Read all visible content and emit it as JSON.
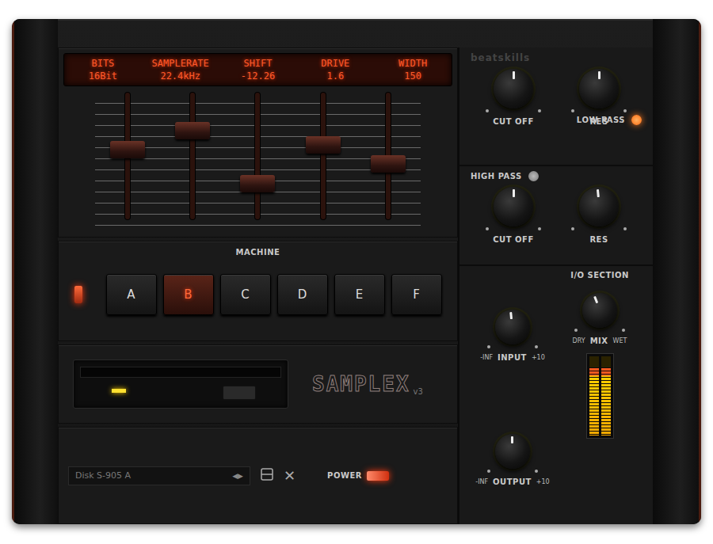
{
  "brand": "beatskills",
  "lcd": [
    {
      "label": "BITS",
      "value": "16Bit",
      "level": 0.56
    },
    {
      "label": "SAMPLERATE",
      "value": "22.4kHz",
      "level": 0.73
    },
    {
      "label": "SHIFT",
      "value": "-12.26",
      "level": 0.25
    },
    {
      "label": "DRIVE",
      "value": "1.6",
      "level": 0.6
    },
    {
      "label": "WIDTH",
      "value": "150",
      "level": 0.43
    }
  ],
  "machine": {
    "label": "MACHINE",
    "switch_on": true,
    "buttons": [
      {
        "label": "A",
        "selected": false
      },
      {
        "label": "B",
        "selected": true
      },
      {
        "label": "C",
        "selected": false
      },
      {
        "label": "D",
        "selected": false
      },
      {
        "label": "E",
        "selected": false
      },
      {
        "label": "F",
        "selected": false
      }
    ]
  },
  "drive": {
    "led_on": true,
    "logo": "SAMPLEX",
    "version": "v3"
  },
  "preset": {
    "name": "Disk S-905 A",
    "arrows": "◀▶",
    "close": "✕"
  },
  "power": {
    "label": "POWER",
    "on": true
  },
  "low_pass": {
    "label": "LOW PASS",
    "on": true,
    "knobs": [
      {
        "label": "CUT OFF",
        "level": 0.5
      },
      {
        "label": "RES",
        "level": 0.5
      }
    ]
  },
  "high_pass": {
    "label": "HIGH PASS",
    "on": false,
    "knobs": [
      {
        "label": "CUT OFF",
        "level": 0.5
      },
      {
        "label": "RES",
        "level": 0.48
      }
    ]
  },
  "io": {
    "title": "I/O SECTION",
    "mix": {
      "label": "MIX",
      "min": "DRY",
      "max": "WET",
      "level": 0.42
    },
    "input": {
      "label": "INPUT",
      "min": "-INF",
      "max": "+10",
      "level": 0.48
    },
    "output": {
      "label": "OUTPUT",
      "min": "-INF",
      "max": "+10",
      "level": 0.5
    }
  },
  "meter": [
    {
      "level": 0.86
    },
    {
      "level": 0.86
    }
  ]
}
